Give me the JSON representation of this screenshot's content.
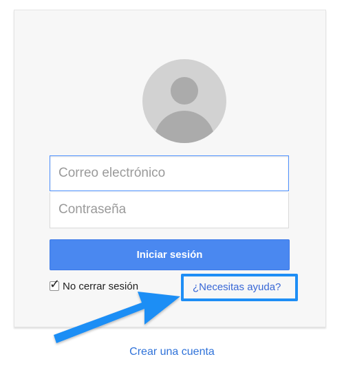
{
  "login": {
    "email_placeholder": "Correo electrónico",
    "password_placeholder": "Contraseña",
    "signin_label": "Iniciar sesión",
    "stay_signed_in_label": "No cerrar sesión",
    "stay_signed_in_checked": true,
    "help_link": "¿Necesitas ayuda?",
    "create_account_link": "Crear una cuenta"
  },
  "colors": {
    "primary_button": "#4a88f0",
    "link": "#3867d6",
    "annotation": "#1e8ef5"
  },
  "icons": {
    "avatar": "avatar-icon",
    "checkmark": "checkmark-icon",
    "annotation_arrow": "arrow-icon"
  }
}
